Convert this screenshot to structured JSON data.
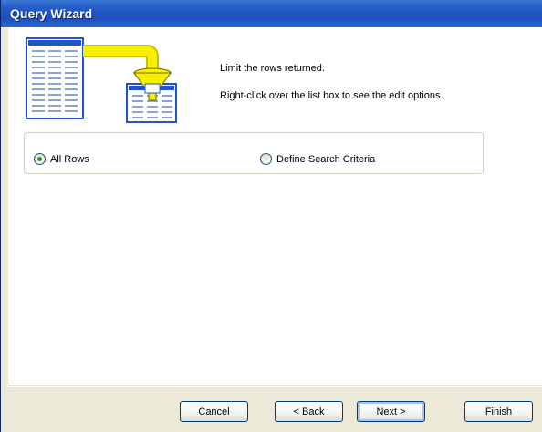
{
  "window": {
    "title": "Query Wizard"
  },
  "banner": {
    "line1": "Limit the rows returned.",
    "line2": "Right-click over the list box to see the edit options."
  },
  "options": {
    "all_rows": {
      "label": "All Rows",
      "selected": true
    },
    "define_search": {
      "label": "Define Search Criteria",
      "selected": false
    }
  },
  "buttons": {
    "cancel": "Cancel",
    "back": "< Back",
    "next": "Next >",
    "finish": "Finish"
  },
  "colors": {
    "titlebar": "#1f56c4",
    "window_face": "#ece9d8",
    "funnel_yellow": "#f8f000",
    "table_blue": "#1f56c4"
  },
  "icons": [
    "table-icon",
    "funnel-icon"
  ]
}
